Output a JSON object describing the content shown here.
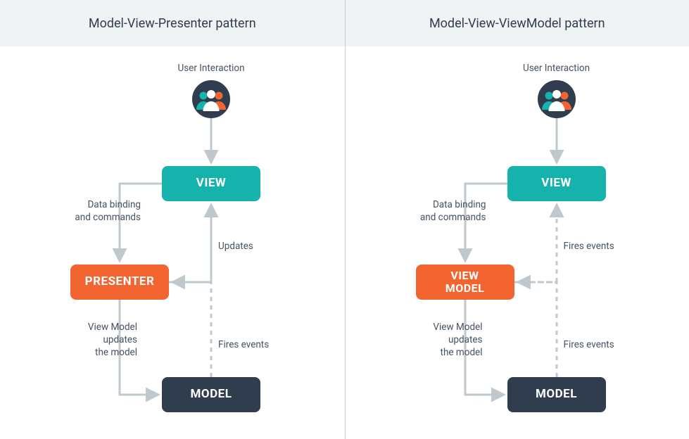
{
  "left": {
    "title": "Model-View-Presenter pattern",
    "user_interaction": "User Interaction",
    "view": "VIEW",
    "middle": "PRESENTER",
    "model": "MODEL",
    "lbl_binding": "Data binding\nand commands",
    "lbl_updates": "Updates",
    "lbl_vm_updates": "View Model\nupdates\nthe model",
    "lbl_fires": "Fires events",
    "middle_arrow_dashed": false
  },
  "right": {
    "title": "Model-View-ViewModel pattern",
    "user_interaction": "User Interaction",
    "view": "VIEW",
    "middle": "VIEW MODEL",
    "model": "MODEL",
    "lbl_binding": "Data binding\nand commands",
    "lbl_updates": "Fires events",
    "lbl_vm_updates": "View Model\nupdates\nthe model",
    "lbl_fires": "Fires events",
    "middle_arrow_dashed": true
  },
  "colors": {
    "teal": "#16B3AC",
    "orange": "#F26531",
    "dark": "#2F3D4F",
    "arrow": "#BFC8CC"
  }
}
